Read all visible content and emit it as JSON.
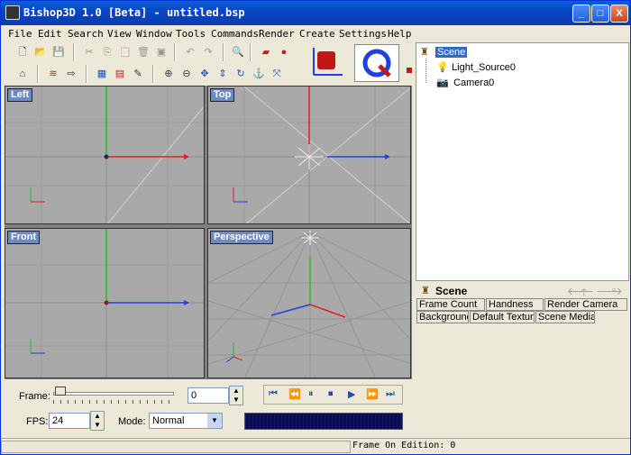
{
  "window": {
    "title": "Bishop3D 1.0 [Beta] - untitled.bsp",
    "min_label": "_",
    "max_label": "□",
    "close_label": "X"
  },
  "menu": [
    "File",
    "Edit",
    "Search",
    "View",
    "Window",
    "Tools",
    "Commands",
    "Render",
    "Create",
    "Settings",
    "Help"
  ],
  "viewports": {
    "left": "Left",
    "top": "Top",
    "front": "Front",
    "perspective": "Perspective"
  },
  "tree": {
    "root": "Scene",
    "children": [
      "Light_Source0",
      "Camera0"
    ]
  },
  "panel": {
    "title": "Scene",
    "tabs": [
      "Frame Count",
      "Handness",
      "Render Camera",
      "Background",
      "Default Texture",
      "Scene Medias"
    ]
  },
  "bottom": {
    "frame_label": "Frame:",
    "frame_value": "0",
    "fps_label": "FPS:",
    "fps_value": "24",
    "mode_label": "Mode:",
    "mode_value": "Normal"
  },
  "status": {
    "text": "Frame On Edition: 0"
  },
  "colors": {
    "title_bar": "#0a5fd8",
    "viewport_bg": "#a9a9a9",
    "viewport_label": "#6e8ac4",
    "axis_x": "#e02020",
    "axis_y": "#20c020",
    "axis_z": "#2040e0",
    "frame_indicator": "#0a0a50"
  }
}
